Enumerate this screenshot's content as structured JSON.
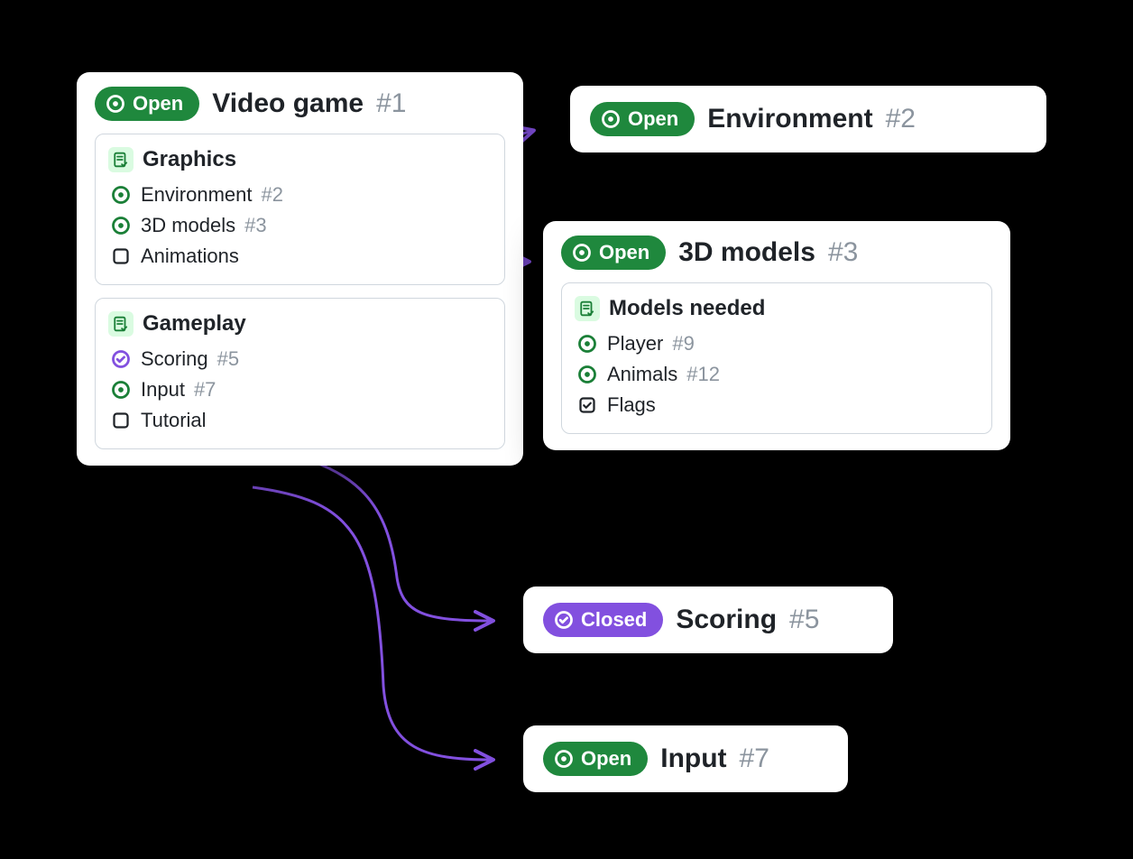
{
  "cards": {
    "video_game": {
      "status_label": "Open",
      "title": "Video game",
      "number": "#1",
      "sections": {
        "graphics": {
          "title": "Graphics",
          "items": {
            "env": {
              "label": "Environment",
              "number": "#2"
            },
            "models": {
              "label": "3D models",
              "number": "#3"
            },
            "anim": {
              "label": "Animations"
            }
          }
        },
        "gameplay": {
          "title": "Gameplay",
          "items": {
            "scoring": {
              "label": "Scoring",
              "number": "#5"
            },
            "input": {
              "label": "Input",
              "number": "#7"
            },
            "tutorial": {
              "label": "Tutorial"
            }
          }
        }
      }
    },
    "environment": {
      "status_label": "Open",
      "title": "Environment",
      "number": "#2"
    },
    "models": {
      "status_label": "Open",
      "title": "3D models",
      "number": "#3",
      "sections": {
        "needed": {
          "title": "Models needed",
          "items": {
            "player": {
              "label": "Player",
              "number": "#9"
            },
            "animals": {
              "label": "Animals",
              "number": "#12"
            },
            "flags": {
              "label": "Flags"
            }
          }
        }
      }
    },
    "scoring": {
      "status_label": "Closed",
      "title": "Scoring",
      "number": "#5"
    },
    "input": {
      "status_label": "Open",
      "title": "Input",
      "number": "#7"
    }
  },
  "colors": {
    "green": "#1f883d",
    "purple": "#8250df",
    "text_muted": "#8b949e",
    "border": "#d0d7de",
    "tasklist_bg": "#dafbe1"
  }
}
